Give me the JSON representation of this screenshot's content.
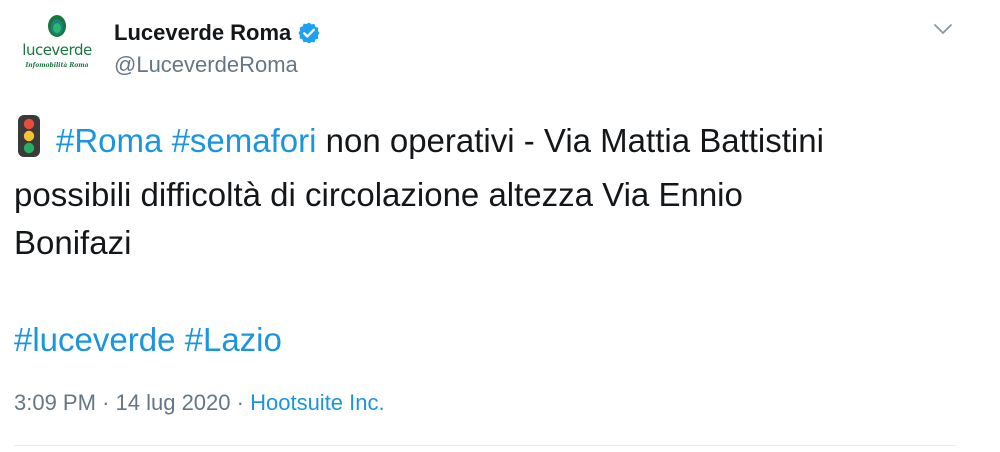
{
  "author": {
    "display_name": "Luceverde Roma",
    "handle": "@LuceverdeRoma",
    "avatar_wordmark": "luceverde",
    "avatar_tagline": "Infomobilità Roma",
    "brand_color": "#18763e",
    "verified_color": "#1da1f2"
  },
  "tweet": {
    "emoji_icon": "traffic-light-icon",
    "line1": {
      "tag1": "#Roma",
      "tag2": "#semafori",
      "text": "non operativi - Via Mattia Battistini"
    },
    "line2": "possibili difficoltà di circolazione altezza Via Ennio",
    "line3": "Bonifazi",
    "tags": [
      "#luceverde",
      "#Lazio"
    ],
    "link_color": "#1b95e0"
  },
  "meta": {
    "time": "3:09 PM",
    "separator": "·",
    "date": "14 lug 2020",
    "source": "Hootsuite Inc."
  }
}
